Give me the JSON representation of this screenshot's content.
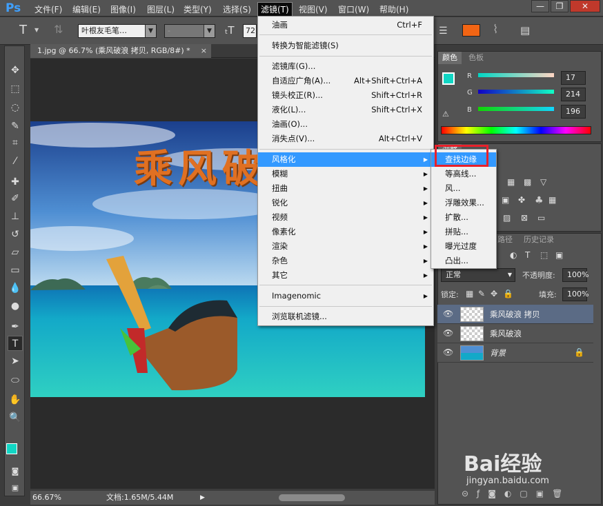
{
  "app": {
    "logo": "Ps"
  },
  "menubar": {
    "items": [
      "文件(F)",
      "编辑(E)",
      "图像(I)",
      "图层(L)",
      "类型(Y)",
      "选择(S)",
      "滤镜(T)",
      "视图(V)",
      "窗口(W)",
      "帮助(H)"
    ],
    "active": "滤镜(T)"
  },
  "window_controls": {
    "minimize": "—",
    "restore": "❐",
    "close": "✕"
  },
  "options_bar": {
    "font_family": "叶根友毛笔…",
    "font_style": "-",
    "font_size": "72",
    "text_color": "#f26514"
  },
  "document": {
    "tab_title": "1.jpg @ 66.7% (乘风破浪 拷贝, RGB/8#) *",
    "tab_close": "×",
    "image_text": "乘风破浪"
  },
  "status_bar": {
    "zoom": "66.67%",
    "doc_info": "文档:1.65M/5.44M"
  },
  "filter_menu": {
    "items": [
      {
        "label": "油画",
        "shortcut": "Ctrl+F"
      },
      {
        "label": "转换为智能滤镜(S)",
        "shortcut": ""
      },
      {
        "label": "滤镜库(G)...",
        "shortcut": ""
      },
      {
        "label": "自适应广角(A)...",
        "shortcut": "Alt+Shift+Ctrl+A"
      },
      {
        "label": "镜头校正(R)...",
        "shortcut": "Shift+Ctrl+R"
      },
      {
        "label": "液化(L)...",
        "shortcut": "Shift+Ctrl+X"
      },
      {
        "label": "油画(O)...",
        "shortcut": ""
      },
      {
        "label": "消失点(V)...",
        "shortcut": "Alt+Ctrl+V"
      },
      {
        "label": "风格化",
        "shortcut": ""
      },
      {
        "label": "模糊",
        "shortcut": ""
      },
      {
        "label": "扭曲",
        "shortcut": ""
      },
      {
        "label": "锐化",
        "shortcut": ""
      },
      {
        "label": "视频",
        "shortcut": ""
      },
      {
        "label": "像素化",
        "shortcut": ""
      },
      {
        "label": "渲染",
        "shortcut": ""
      },
      {
        "label": "杂色",
        "shortcut": ""
      },
      {
        "label": "其它",
        "shortcut": ""
      },
      {
        "label": "Imagenomic",
        "shortcut": ""
      },
      {
        "label": "浏览联机滤镜...",
        "shortcut": ""
      }
    ]
  },
  "stylize_submenu": {
    "items": [
      "查找边缘",
      "等高线...",
      "风...",
      "浮雕效果...",
      "扩散...",
      "拼贴...",
      "曝光过度",
      "凸出..."
    ],
    "highlight_color": "#e8202a"
  },
  "color_panel": {
    "tabs": [
      "颜色",
      "色板"
    ],
    "r": "17",
    "g": "214",
    "b": "196",
    "r_label": "R",
    "g_label": "G",
    "b_label": "B",
    "foreground": "#11d6c4"
  },
  "adjust_panel": {
    "tab_fragment": "调整"
  },
  "layers_panel": {
    "tabs": [
      "路径",
      "历史记录"
    ],
    "blend_mode": "正常",
    "opacity_label": "不透明度:",
    "opacity": "100%",
    "lock_label": "锁定:",
    "fill_label": "填充:",
    "fill": "100%",
    "layers": [
      {
        "name": "乘风破浪 拷贝",
        "selected": true
      },
      {
        "name": "乘风破浪",
        "selected": false
      },
      {
        "name": "背景",
        "selected": false
      }
    ]
  },
  "watermark": {
    "brand": "Bai经验",
    "url": "jingyan.baidu.com"
  }
}
